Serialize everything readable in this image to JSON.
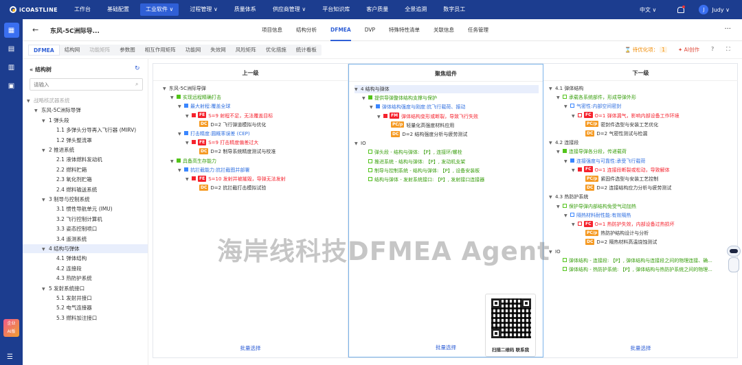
{
  "app": {
    "logo": "iCOASTLINE"
  },
  "topnav": [
    {
      "label": "工作台",
      "active": false
    },
    {
      "label": "基础配置",
      "active": false
    },
    {
      "label": "工业软件 ∨",
      "active": true
    },
    {
      "label": "过程管理 ∨",
      "active": false
    },
    {
      "label": "质量体系",
      "active": false
    },
    {
      "label": "供应商管理 ∨",
      "active": false
    },
    {
      "label": "平台知识库",
      "active": false
    },
    {
      "label": "客户质量",
      "active": false
    },
    {
      "label": "全景追溯",
      "active": false
    },
    {
      "label": "数字员工",
      "active": false
    }
  ],
  "topright": {
    "language": "中文 ∨",
    "avatar": "J",
    "user": "Judy ∨"
  },
  "leftrail": {
    "ai_label_1": "企业",
    "ai_label_2": "AI版",
    "collapse": "☰"
  },
  "header": {
    "back": "←",
    "title": "东风-5C洲际导...",
    "tabs": [
      "项目信息",
      "结构分析",
      "DFMEA",
      "DVP",
      "特殊特性清单",
      "关联信息",
      "任务管理"
    ],
    "active_tab": "DFMEA",
    "more": "···"
  },
  "subtabs": {
    "items": [
      "DFMEA",
      "结构网",
      "功能矩阵",
      "参数图",
      "相互作用矩阵",
      "功能网",
      "失效网",
      "风险矩阵",
      "优化措施",
      "统计看板"
    ],
    "active": "DFMEA",
    "dim": [
      "功能矩阵"
    ],
    "pending_label": "待优化项：",
    "pending_count": "1",
    "ai_create": "AI创作"
  },
  "tree": {
    "title": "结构树",
    "search_placeholder": "请输入",
    "nodes": [
      {
        "label": "战略核武器系统",
        "level": 1,
        "arrow": "▼",
        "dim": true
      },
      {
        "label": "东风-5C洲际导弹",
        "level": 2,
        "arrow": "▼"
      },
      {
        "label": "1 弹头段",
        "level": 3,
        "arrow": "▼"
      },
      {
        "label": "1.1 多弹头分导再入飞行器 (MIRV)",
        "level": 4
      },
      {
        "label": "1.2 弹头整流罩",
        "level": 4
      },
      {
        "label": "2 推进系统",
        "level": 3,
        "arrow": "▼"
      },
      {
        "label": "2.1 液体燃料发动机",
        "level": 4
      },
      {
        "label": "2.2 燃料贮箱",
        "level": 4
      },
      {
        "label": "2.3 氧化剂贮箱",
        "level": 4
      },
      {
        "label": "2.4 燃料输送系统",
        "level": 4
      },
      {
        "label": "3 制导与控制系统",
        "level": 3,
        "arrow": "▼"
      },
      {
        "label": "3.1 惯性导航单元 (IMU)",
        "level": 4
      },
      {
        "label": "3.2 飞行控制计算机",
        "level": 4
      },
      {
        "label": "3.3 姿态控制喷口",
        "level": 4
      },
      {
        "label": "3.4 遥测系统",
        "level": 4
      },
      {
        "label": "4 结构与弹体",
        "level": 3,
        "arrow": "▼",
        "selected": true
      },
      {
        "label": "4.1 弹体结构",
        "level": 4
      },
      {
        "label": "4.2 连接段",
        "level": 4
      },
      {
        "label": "4.3 热防护系统",
        "level": 4
      },
      {
        "label": "5 发射系统接口",
        "level": 3,
        "arrow": "▼"
      },
      {
        "label": "5.1 发射井接口",
        "level": 4
      },
      {
        "label": "5.2 电气连接器",
        "level": 4
      },
      {
        "label": "5.3 燃料加注接口",
        "level": 4
      }
    ]
  },
  "columns": {
    "upper": {
      "title": "上一级",
      "batch": "批量选择"
    },
    "focus": {
      "title": "聚焦组件",
      "batch": "批量选择"
    },
    "lower": {
      "title": "下一级",
      "batch": "批量选择"
    }
  },
  "upper_rows": [
    {
      "indent": 0,
      "arrow": "▼",
      "text": "东风-5C洲际导弹",
      "color": "k"
    },
    {
      "indent": 1,
      "arrow": "▼",
      "icon": "g",
      "text": "实现远程精确打击",
      "color": "g"
    },
    {
      "indent": 2,
      "arrow": "▼",
      "icon": "b",
      "text": "最大射程:覆盖全球",
      "color": "b"
    },
    {
      "indent": 3,
      "arrow": "▼",
      "icon": "rd",
      "tag": "FE",
      "tagc": "fe",
      "text": "S=9 射程不足，无法覆盖目标",
      "color": "r"
    },
    {
      "indent": 4,
      "tag": "DC",
      "tagc": "dc",
      "text": "D=2  飞行弹道模拟与优化",
      "color": "k"
    },
    {
      "indent": 2,
      "arrow": "▼",
      "icon": "b",
      "text": "打击精度:圆概率误差 (CEP)",
      "color": "b"
    },
    {
      "indent": 3,
      "arrow": "▼",
      "icon": "rd",
      "tag": "FE",
      "tagc": "fe",
      "text": "S=9 打击精度偏差过大",
      "color": "r"
    },
    {
      "indent": 4,
      "tag": "DC",
      "tagc": "dc",
      "text": "D=2  制导系统精度测试与校准",
      "color": "k"
    },
    {
      "indent": 1,
      "arrow": "▼",
      "icon": "g",
      "text": "具备高生存能力",
      "color": "g"
    },
    {
      "indent": 2,
      "arrow": "▼",
      "icon": "b",
      "text": "抗拦截能力:抗拦截图并部署",
      "color": "b"
    },
    {
      "indent": 3,
      "arrow": "▼",
      "icon": "rd",
      "tag": "FE",
      "tagc": "fe",
      "text": "S=10 发射并被摧毁，导弹无法发射",
      "color": "r"
    },
    {
      "indent": 4,
      "tag": "DC",
      "tagc": "dc",
      "text": "D=2  抗拦截打击模拟试验",
      "color": "k"
    }
  ],
  "focus_rows": [
    {
      "indent": 0,
      "arrow": "▼",
      "text": "4 结构与弹体",
      "color": "k",
      "hl": true
    },
    {
      "indent": 1,
      "arrow": "▼",
      "icon": "g",
      "text": "提供导弹整体结构支撑与保护",
      "color": "g"
    },
    {
      "indent": 2,
      "arrow": "▼",
      "icon": "b",
      "text": "弹体结构强度与刚度:抗飞行载荷、振动",
      "color": "b"
    },
    {
      "indent": 3,
      "arrow": "▼",
      "icon": "rd",
      "tag": "FM",
      "tagc": "fm",
      "text": "弹体结构变形或断裂，导致飞行失败",
      "color": "r"
    },
    {
      "indent": 4,
      "tag": "PC/p",
      "tagc": "pc",
      "text": "轻量化高强度材料应用",
      "color": "k"
    },
    {
      "indent": 4,
      "tag": "DC",
      "tagc": "dc",
      "text": "D=2  结构强度分析与疲劳测试",
      "color": "k"
    },
    {
      "indent": 0,
      "arrow": "▼",
      "text": "IO",
      "color": "k"
    },
    {
      "indent": 1,
      "icon": "o",
      "text": "弹头段 - 结构与弹体: 【P】, 连接环/螺栓",
      "color": "g"
    },
    {
      "indent": 1,
      "icon": "o",
      "text": "推进系统 - 结构与弹体: 【P】, 发动机支架",
      "color": "g"
    },
    {
      "indent": 1,
      "icon": "o",
      "text": "制导与控制系统 - 结构与弹体: 【P】, 设备安装板",
      "color": "g"
    },
    {
      "indent": 1,
      "icon": "o",
      "text": "结构与弹体 - 发射系统接口: 【P】, 发射接口连接器",
      "color": "g"
    }
  ],
  "lower_rows": [
    {
      "indent": 0,
      "arrow": "▼",
      "text": "4.1 弹体结构",
      "color": "k"
    },
    {
      "indent": 1,
      "arrow": "▼",
      "icon": "o",
      "text": "承载各系统部件，形成导弹外形",
      "color": "g"
    },
    {
      "indent": 2,
      "arrow": "▼",
      "icon": "ob",
      "text": "气密性:内部空间密封",
      "color": "b"
    },
    {
      "indent": 3,
      "arrow": "▼",
      "icon": "or",
      "tag": "FC",
      "tagc": "fc",
      "text": "O=1 弹体漏气，影响内部设备工作环境",
      "color": "r"
    },
    {
      "indent": 4,
      "tag": "PC/p",
      "tagc": "pc",
      "text": "密封件选型与安装工艺优化",
      "color": "k"
    },
    {
      "indent": 4,
      "tag": "DC",
      "tagc": "dc",
      "text": "D=2  气密性测试与检漏",
      "color": "k"
    },
    {
      "indent": 0,
      "arrow": "▼",
      "text": "4.2 连接段",
      "color": "k"
    },
    {
      "indent": 1,
      "arrow": "▼",
      "icon": "g",
      "text": "连接导弹各分段，传递载荷",
      "color": "g"
    },
    {
      "indent": 2,
      "arrow": "▼",
      "icon": "b",
      "text": "连接强度与可靠性:承受飞行载荷",
      "color": "b"
    },
    {
      "indent": 3,
      "arrow": "▼",
      "icon": "rd",
      "tag": "FC",
      "tagc": "fc",
      "text": "O=1 连接段断裂或松动，导致解体",
      "color": "r"
    },
    {
      "indent": 4,
      "tag": "PC/p",
      "tagc": "pc",
      "text": "紧固件选型与安装工艺控制",
      "color": "k"
    },
    {
      "indent": 4,
      "tag": "DC",
      "tagc": "dc",
      "text": "D=2  连接结构应力分析与疲劳测试",
      "color": "k"
    },
    {
      "indent": 0,
      "arrow": "▼",
      "text": "4.3 热防护系统",
      "color": "k"
    },
    {
      "indent": 1,
      "arrow": "▼",
      "icon": "o",
      "text": "保护导弹内部结构免受气动加热",
      "color": "g"
    },
    {
      "indent": 2,
      "arrow": "▼",
      "icon": "ob",
      "text": "隔热材料耐性能:有效隔热",
      "color": "b"
    },
    {
      "indent": 3,
      "arrow": "▼",
      "icon": "or",
      "tag": "FC",
      "tagc": "fc",
      "text": "O=1 热防护失效，内部设备过热损坏",
      "color": "r"
    },
    {
      "indent": 4,
      "tag": "PC/p",
      "tagc": "pc",
      "text": "热防护结构设计与分析",
      "color": "k"
    },
    {
      "indent": 4,
      "tag": "DC",
      "tagc": "dc",
      "text": "D=2  隔热材料高温烧蚀测试",
      "color": "k"
    },
    {
      "indent": 0,
      "arrow": "▼",
      "text": "IO",
      "color": "k"
    },
    {
      "indent": 1,
      "icon": "o",
      "text": "弹体结构 - 连接段: 【P】, 弹体结构与连接段之间的物理连接、确...",
      "color": "g"
    },
    {
      "indent": 1,
      "icon": "o",
      "text": "弹体结构 - 热防护系统: 【P】, 弹体结构与热防护系统之间的物理...",
      "color": "g"
    }
  ],
  "watermark": "海岸线科技DFMEA Agent",
  "qr_label": "扫描二维码  联系我"
}
